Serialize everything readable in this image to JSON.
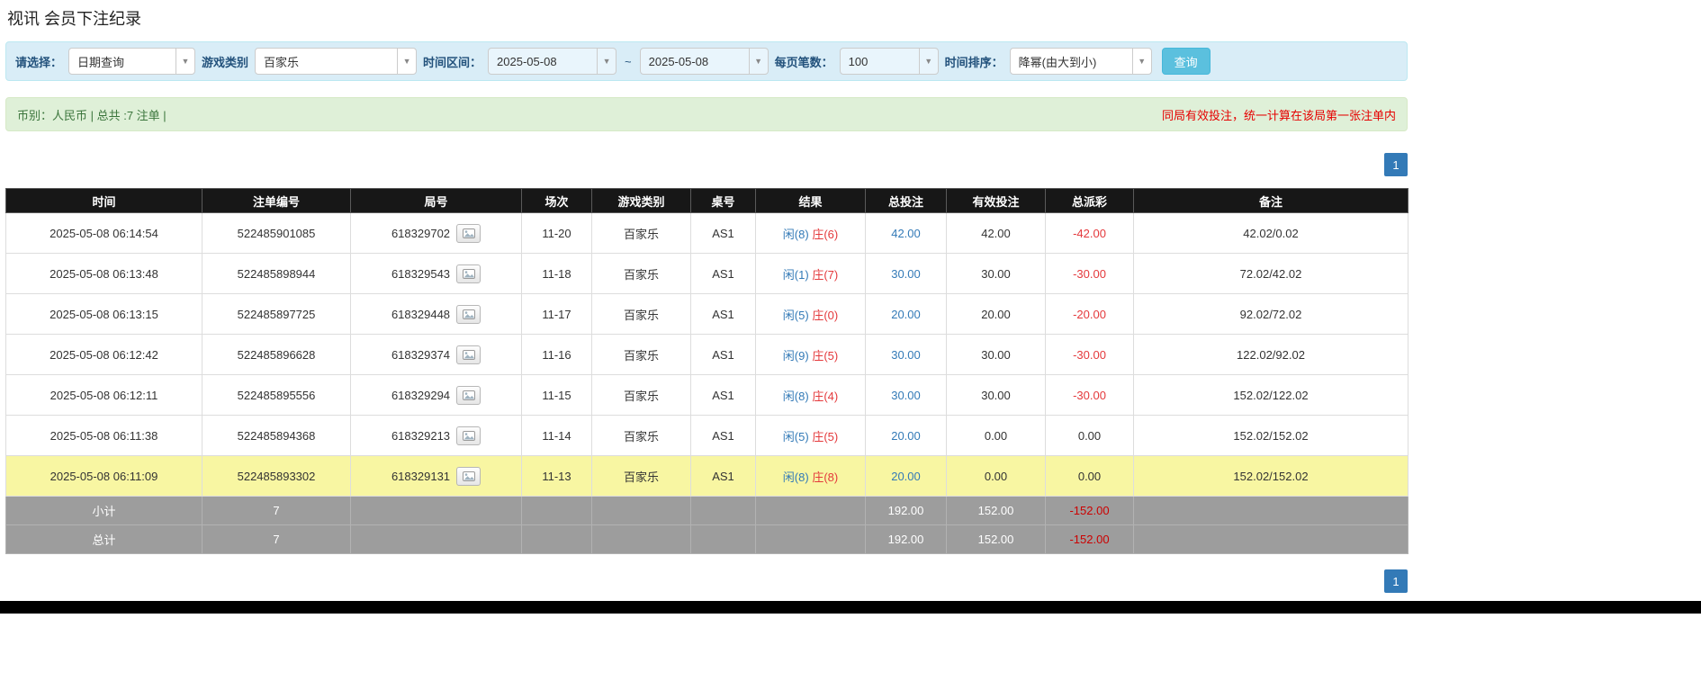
{
  "page": {
    "title": "视讯 会员下注纪录"
  },
  "filter": {
    "select_label": "请选择：",
    "select_value": "日期查询",
    "game_type_label": "游戏类别",
    "game_type_value": "百家乐",
    "time_range_label": "时间区间：",
    "date_from": "2025-05-08",
    "range_separator": "~",
    "date_to": "2025-05-08",
    "page_size_label": "每页笔数：",
    "page_size_value": "100",
    "sort_label": "时间排序：",
    "sort_value": "降幂(由大到小)",
    "search_button_label": "查询"
  },
  "summary": {
    "left_text": "币别：人民币 | 总共 :7 注单 |",
    "right_notice": "同局有效投注，统一计算在该局第一张注单内"
  },
  "pagination": {
    "current_page": "1"
  },
  "table": {
    "headers": [
      "时间",
      "注单编号",
      "局号",
      "场次",
      "游戏类别",
      "桌号",
      "结果",
      "总投注",
      "有效投注",
      "总派彩",
      "备注"
    ],
    "rows": [
      {
        "time": "2025-05-08 06:14:54",
        "bet_id": "522485901085",
        "round_id": "618329702",
        "session": "11-20",
        "game": "百家乐",
        "table_no": "AS1",
        "result_player": "闲(8)",
        "result_banker": "庄(6)",
        "total_bet": "42.00",
        "valid_bet": "42.00",
        "payout": "-42.00",
        "remark": "42.02/0.02",
        "highlight": false
      },
      {
        "time": "2025-05-08 06:13:48",
        "bet_id": "522485898944",
        "round_id": "618329543",
        "session": "11-18",
        "game": "百家乐",
        "table_no": "AS1",
        "result_player": "闲(1)",
        "result_banker": "庄(7)",
        "total_bet": "30.00",
        "valid_bet": "30.00",
        "payout": "-30.00",
        "remark": "72.02/42.02",
        "highlight": false
      },
      {
        "time": "2025-05-08 06:13:15",
        "bet_id": "522485897725",
        "round_id": "618329448",
        "session": "11-17",
        "game": "百家乐",
        "table_no": "AS1",
        "result_player": "闲(5)",
        "result_banker": "庄(0)",
        "total_bet": "20.00",
        "valid_bet": "20.00",
        "payout": "-20.00",
        "remark": "92.02/72.02",
        "highlight": false
      },
      {
        "time": "2025-05-08 06:12:42",
        "bet_id": "522485896628",
        "round_id": "618329374",
        "session": "11-16",
        "game": "百家乐",
        "table_no": "AS1",
        "result_player": "闲(9)",
        "result_banker": "庄(5)",
        "total_bet": "30.00",
        "valid_bet": "30.00",
        "payout": "-30.00",
        "remark": "122.02/92.02",
        "highlight": false
      },
      {
        "time": "2025-05-08 06:12:11",
        "bet_id": "522485895556",
        "round_id": "618329294",
        "session": "11-15",
        "game": "百家乐",
        "table_no": "AS1",
        "result_player": "闲(8)",
        "result_banker": "庄(4)",
        "total_bet": "30.00",
        "valid_bet": "30.00",
        "payout": "-30.00",
        "remark": "152.02/122.02",
        "highlight": false
      },
      {
        "time": "2025-05-08 06:11:38",
        "bet_id": "522485894368",
        "round_id": "618329213",
        "session": "11-14",
        "game": "百家乐",
        "table_no": "AS1",
        "result_player": "闲(5)",
        "result_banker": "庄(5)",
        "total_bet": "20.00",
        "valid_bet": "0.00",
        "payout": "0.00",
        "remark": "152.02/152.02",
        "highlight": false
      },
      {
        "time": "2025-05-08 06:11:09",
        "bet_id": "522485893302",
        "round_id": "618329131",
        "session": "11-13",
        "game": "百家乐",
        "table_no": "AS1",
        "result_player": "闲(8)",
        "result_banker": "庄(8)",
        "total_bet": "20.00",
        "valid_bet": "0.00",
        "payout": "0.00",
        "remark": "152.02/152.02",
        "highlight": true
      }
    ],
    "subtotal": {
      "label": "小计",
      "count": "7",
      "total_bet": "192.00",
      "valid_bet": "152.00",
      "payout": "-152.00"
    },
    "grand_total": {
      "label": "总计",
      "count": "7",
      "total_bet": "192.00",
      "valid_bet": "152.00",
      "payout": "-152.00"
    }
  },
  "colors": {
    "accent_blue": "#337ab7",
    "player_blue": "#337ab7",
    "banker_red": "#e4393c",
    "negative_red": "#cc0000",
    "highlight_yellow": "#f8f6a2",
    "search_button_blue": "#5bc0de",
    "filter_panel_blue": "#d9edf7",
    "summary_panel_green": "#dff0d8",
    "header_black": "#171717",
    "footer_gray": "#9d9d9d"
  }
}
